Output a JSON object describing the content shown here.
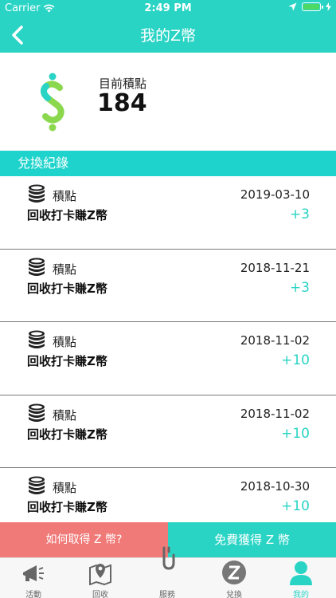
{
  "status_bar": {
    "carrier": "Carrier",
    "time": "2:49 PM"
  },
  "header": {
    "title": "我的Z幣"
  },
  "points": {
    "label": "目前積點",
    "value": "184"
  },
  "section": {
    "title": "兌換紀錄"
  },
  "records": [
    {
      "type": "積點",
      "date": "2019-03-10",
      "desc": "回收打卡賺Z幣",
      "amount": "+3"
    },
    {
      "type": "積點",
      "date": "2018-11-21",
      "desc": "回收打卡賺Z幣",
      "amount": "+3"
    },
    {
      "type": "積點",
      "date": "2018-11-02",
      "desc": "回收打卡賺Z幣",
      "amount": "+10"
    },
    {
      "type": "積點",
      "date": "2018-11-02",
      "desc": "回收打卡賺Z幣",
      "amount": "+10"
    },
    {
      "type": "積點",
      "date": "2018-10-30",
      "desc": "回收打卡賺Z幣",
      "amount": "+10"
    }
  ],
  "actions": {
    "how_label": "如何取得 Z 幣?",
    "free_label": "免費獲得 Z 幣"
  },
  "tabs": [
    {
      "label": "活動",
      "icon": "megaphone-icon"
    },
    {
      "label": "回收",
      "icon": "map-pin-icon"
    },
    {
      "label": "服務",
      "icon": "hook-icon"
    },
    {
      "label": "兌換",
      "icon": "z-coin-icon"
    },
    {
      "label": "我的",
      "icon": "person-icon"
    }
  ],
  "colors": {
    "accent": "#2ad4c5",
    "section": "#1dd3cb",
    "coral": "#f07a78",
    "battery": "#4cd964"
  }
}
